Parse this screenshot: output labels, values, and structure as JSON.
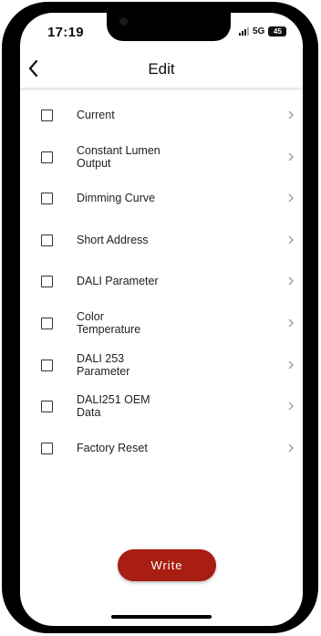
{
  "status_bar": {
    "time": "17:19",
    "network": "5G",
    "battery": "45"
  },
  "header": {
    "title": "Edit",
    "back_icon": "chevron-left-icon"
  },
  "items": [
    {
      "label": "Current"
    },
    {
      "label": "Constant Lumen\nOutput"
    },
    {
      "label": "Dimming Curve"
    },
    {
      "label": "Short Address"
    },
    {
      "label": "DALI Parameter"
    },
    {
      "label": "Color\nTemperature"
    },
    {
      "label": "DALI 253\nParameter"
    },
    {
      "label": "DALI251 OEM\nData"
    },
    {
      "label": "Factory Reset"
    }
  ],
  "actions": {
    "write_label": "Write"
  },
  "colors": {
    "accent": "#a81e12",
    "frame": "#000000",
    "background": "#ffffff"
  }
}
